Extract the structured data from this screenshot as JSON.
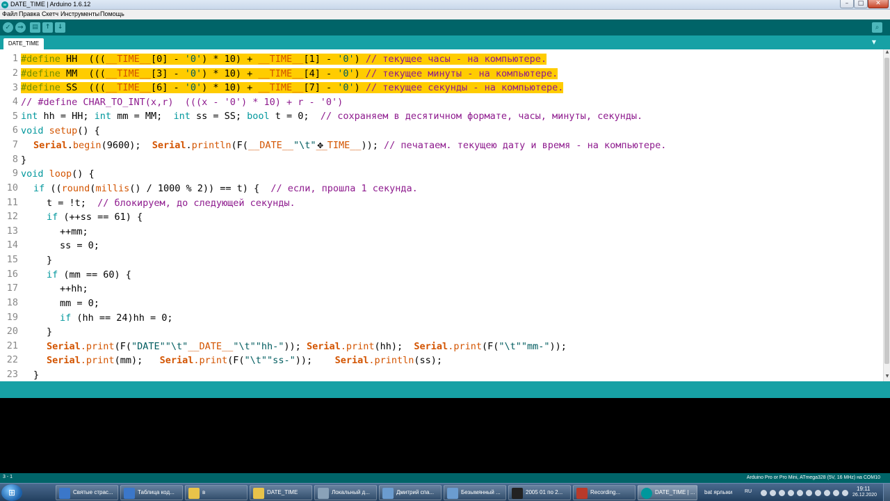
{
  "window": {
    "title": "DATE_TIME | Arduino 1.6.12",
    "min_glyph": "–",
    "max_glyph": "□",
    "close_glyph": "✕"
  },
  "menu": [
    "Файл",
    "Правка",
    "Скетч",
    "Инструменты",
    "Помощь"
  ],
  "toolbar": {
    "verify_glyph": "✓",
    "upload_glyph": "→",
    "new_glyph": "▤",
    "open_glyph": "↑",
    "save_glyph": "↓",
    "serial_glyph": "⌕"
  },
  "tabs": {
    "active": "DATE_TIME",
    "menu_glyph": "▼"
  },
  "scroll": {
    "up": "▲",
    "down": "▼"
  },
  "code": {
    "line_numbers": [
      "1",
      "2",
      "3",
      "4",
      "5",
      "6",
      "7",
      "8",
      "9",
      "10",
      "11",
      "12",
      "13",
      "14",
      "15",
      "16",
      "17",
      "18",
      "19",
      "20",
      "21",
      "22",
      "23"
    ],
    "l1": {
      "dir": "#define",
      "a": " HH  (((",
      "b": "__TIME__",
      "c": "[0] - ",
      "d": "'0'",
      "e": ") * 10) + ",
      "f": "__TIME__",
      "g": "[1] - ",
      "h": "'0'",
      "i": ") ",
      "cm": "// текущее часы - на компьютере."
    },
    "l2": {
      "dir": "#define",
      "a": " MM  (((",
      "b": "__TIME__",
      "c": "[3] - ",
      "d": "'0'",
      "e": ") * 10) + ",
      "f": "__TIME__",
      "g": "[4] - ",
      "h": "'0'",
      "i": ") ",
      "cm": "// текущее минуты - на компьютере."
    },
    "l3": {
      "dir": "#define",
      "a": " SS  (((",
      "b": "__TIME__",
      "c": "[6] - ",
      "d": "'0'",
      "e": ") * 10) + ",
      "f": "__TIME__",
      "g": "[7] - ",
      "h": "'0'",
      "i": ") ",
      "cm": "// текущее секунды - на компьютере."
    },
    "l4": "// #define CHAR_TO_INT(x,r)  (((x - '0') * 10) + r - '0')",
    "l5": {
      "t1": "int",
      "a": " hh = HH; ",
      "t2": "int",
      "b": " mm = MM;  ",
      "t3": "int",
      "c": " ss = SS; ",
      "t4": "bool",
      "d": " t = 0;  ",
      "cm": "// сохраняем в десятичном формате, часы, минуты, секунды."
    },
    "l6": {
      "t": "void",
      "f": "setup",
      "a": "() {"
    },
    "l7": {
      "cls1": "Serial",
      "dot1": ".",
      "f1": "begin",
      "a": "(9600);  ",
      "cls2": "Serial",
      "dot2": ".",
      "f2": "println",
      "b": "(F(",
      "c": "__DATE__",
      "s": "\"\\t\"",
      "d": "__TIME__",
      "e": ")); ",
      "cm": "// печатаем. текущею дату и время - на компьютере."
    },
    "l8": "}",
    "l9": {
      "t": "void",
      "f": "loop",
      "a": "() {"
    },
    "l10": {
      "kw": "if",
      "a": " ((",
      "f1": "round",
      "b": "(",
      "f2": "millis",
      "c": "() / 1000 % 2)) == t) {  ",
      "cm": "// если, прошла 1 секунда."
    },
    "l11": {
      "a": "t = !t;  ",
      "cm": "// блокируем, до следующей секунды."
    },
    "l12": {
      "kw": "if",
      "a": " (++ss == 61) {"
    },
    "l13": "++mm;",
    "l14": "ss = 0;",
    "l15": "}",
    "l16": {
      "kw": "if",
      "a": " (mm == 60) {"
    },
    "l17": "++hh;",
    "l18": "mm = 0;",
    "l19": {
      "kw": "if",
      "a": " (hh == 24)hh = 0;"
    },
    "l20": "}",
    "l21": {
      "cls1": "Serial",
      "f1": ".print",
      "a": "(F(",
      "s1": "\"DATE\"\"\\t\"",
      "b": "__DATE__",
      "s2": "\"\\t\"\"hh-\"",
      "c": ")); ",
      "cls2": "Serial",
      "f2": ".print",
      "d": "(hh);  ",
      "cls3": "Serial",
      "f3": ".print",
      "e": "(F(",
      "s3": "\"\\t\"\"mm-\"",
      "g": "));"
    },
    "l22": {
      "cls1": "Serial",
      "f1": ".print",
      "a": "(mm);   ",
      "cls2": "Serial",
      "f2": ".print",
      "b": "(F(",
      "s1": "\"\\t\"\"ss-\"",
      "c": "));    ",
      "cls3": "Serial",
      "f3": ".println",
      "d": "(ss);"
    },
    "l23": "}"
  },
  "status": {
    "line_col": "3 - 1",
    "board": "Arduino Pro or Pro Mini, ATmega328 (5V, 16 MHz) на COM10"
  },
  "taskbar": {
    "start_glyph": "⊞",
    "items": [
      {
        "label": "Святые страс...",
        "color": "#3b77c9"
      },
      {
        "label": "Таблица код...",
        "color": "#3b77c9"
      },
      {
        "label": "в",
        "color": "#e8c34a"
      },
      {
        "label": "DATE_TIME",
        "color": "#e8c34a"
      },
      {
        "label": "Локальный д...",
        "color": "#8aa2b8"
      },
      {
        "label": "Дмитрий спа...",
        "color": "#6b9ccf"
      },
      {
        "label": "Безымянный ...",
        "color": "#6b9ccf"
      },
      {
        "label": "2005 01 по 2...",
        "color": "#222222"
      },
      {
        "label": "Recording...",
        "color": "#b83a2a"
      },
      {
        "label": "DATE_TIME | ...",
        "color": "#00979c"
      }
    ],
    "tray_label": "bat ярлыки",
    "lang": "RU",
    "time": "19:11",
    "date": "26.12.2020"
  }
}
